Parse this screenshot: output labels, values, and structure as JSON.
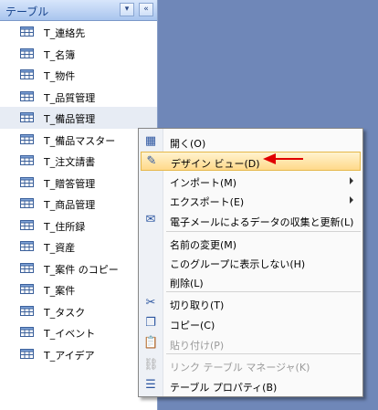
{
  "nav_pane": {
    "title": "テーブル",
    "dropdown_glyph": "▾",
    "collapse_glyph": "«",
    "items": [
      {
        "label": "T_連絡先"
      },
      {
        "label": "T_名簿"
      },
      {
        "label": "T_物件"
      },
      {
        "label": "T_品質管理"
      },
      {
        "label": "T_備品管理",
        "selected": true
      },
      {
        "label": "T_備品マスター"
      },
      {
        "label": "T_注文請書"
      },
      {
        "label": "T_贈答管理"
      },
      {
        "label": "T_商品管理"
      },
      {
        "label": "T_住所録"
      },
      {
        "label": "T_資産"
      },
      {
        "label": "T_案件 のコピー"
      },
      {
        "label": "T_案件"
      },
      {
        "label": "T_タスク"
      },
      {
        "label": "T_イベント"
      },
      {
        "label": "T_アイデア"
      }
    ]
  },
  "context_menu": {
    "items": [
      {
        "label": "開く(O)",
        "icon": "open-table-icon"
      },
      {
        "label": "デザイン ビュー(D)",
        "icon": "design-view-icon",
        "highlighted": true
      },
      {
        "label": "インポート(M)",
        "submenu": true
      },
      {
        "label": "エクスポート(E)",
        "submenu": true
      },
      {
        "label": "電子メールによるデータの収集と更新(L)",
        "icon": "collect-data-icon"
      },
      {
        "label": "名前の変更(M)"
      },
      {
        "label": "このグループに表示しない(H)"
      },
      {
        "label": "削除(L)"
      },
      {
        "label": "切り取り(T)",
        "icon": "scissors-icon"
      },
      {
        "label": "コピー(C)",
        "icon": "copy-icon"
      },
      {
        "label": "貼り付け(P)",
        "icon": "paste-icon",
        "disabled": true
      },
      {
        "label": "リンク テーブル マネージャ(K)",
        "icon": "linked-table-manager-icon",
        "disabled": true
      },
      {
        "label": "テーブル プロパティ(B)",
        "icon": "table-properties-icon"
      }
    ]
  },
  "colors": {
    "desktop": "#6f87b8",
    "highlight": "#ffd98a",
    "annotation_arrow": "#e00000"
  }
}
